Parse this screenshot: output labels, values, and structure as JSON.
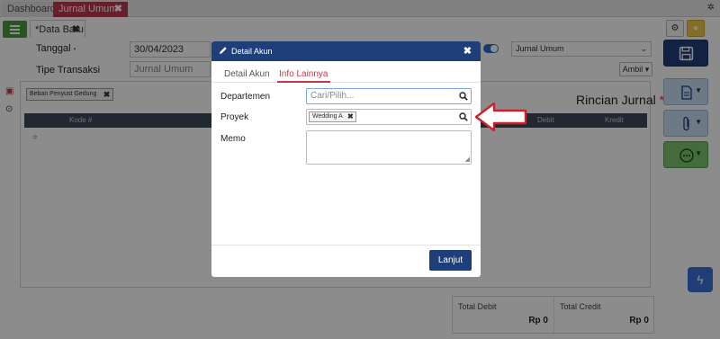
{
  "topbar": {
    "tabs": [
      {
        "label": "Dashboard"
      },
      {
        "label": "Jurnal Umum"
      }
    ],
    "close_glyph": "✖",
    "settings_glyph": "✲"
  },
  "page_tab": {
    "label": "*Data Baru",
    "close_glyph": "✖"
  },
  "form": {
    "tanggal_label": "Tanggal",
    "tanggal_req": "•",
    "tanggal_value": "30/04/2023",
    "tipe_label": "Tipe Transaksi",
    "tipe_value": "Jurnal Umum",
    "jurnal_select": "Jurnal Umum",
    "ambil_label": "Ambil ▾"
  },
  "content": {
    "account_chip": "Beban Penyust Gedung",
    "rincian_title": "Rincian Jurnal",
    "rincian_req": "*",
    "columns": [
      "Kode #",
      "Debit",
      "Kredit"
    ]
  },
  "totals": {
    "debit_label": "Total Debit",
    "debit_value": "Rp 0",
    "credit_label": "Total Credit",
    "credit_value": "Rp 0"
  },
  "modal": {
    "title": "Detail Akun",
    "close_glyph": "✖",
    "tabs": [
      {
        "label": "Detail Akun",
        "active": false
      },
      {
        "label": "Info Lainnya",
        "active": true
      }
    ],
    "departemen_label": "Departemen",
    "departemen_placeholder": "Cari/Pilih...",
    "proyek_label": "Proyek",
    "proyek_tag": "Wedding A",
    "tag_close_glyph": "✖",
    "memo_label": "Memo",
    "submit_label": "Lanjut"
  },
  "colors": {
    "brand_navy": "#1f3f7a",
    "accent_red": "#c0394b",
    "success_green": "#4a9a3a"
  },
  "icons": [
    "menu-icon",
    "gear-icon",
    "lightbulb-icon",
    "save-icon",
    "document-icon",
    "paperclip-icon",
    "more-icon",
    "pencil-icon",
    "search-icon",
    "history-icon",
    "arrow-callout"
  ]
}
